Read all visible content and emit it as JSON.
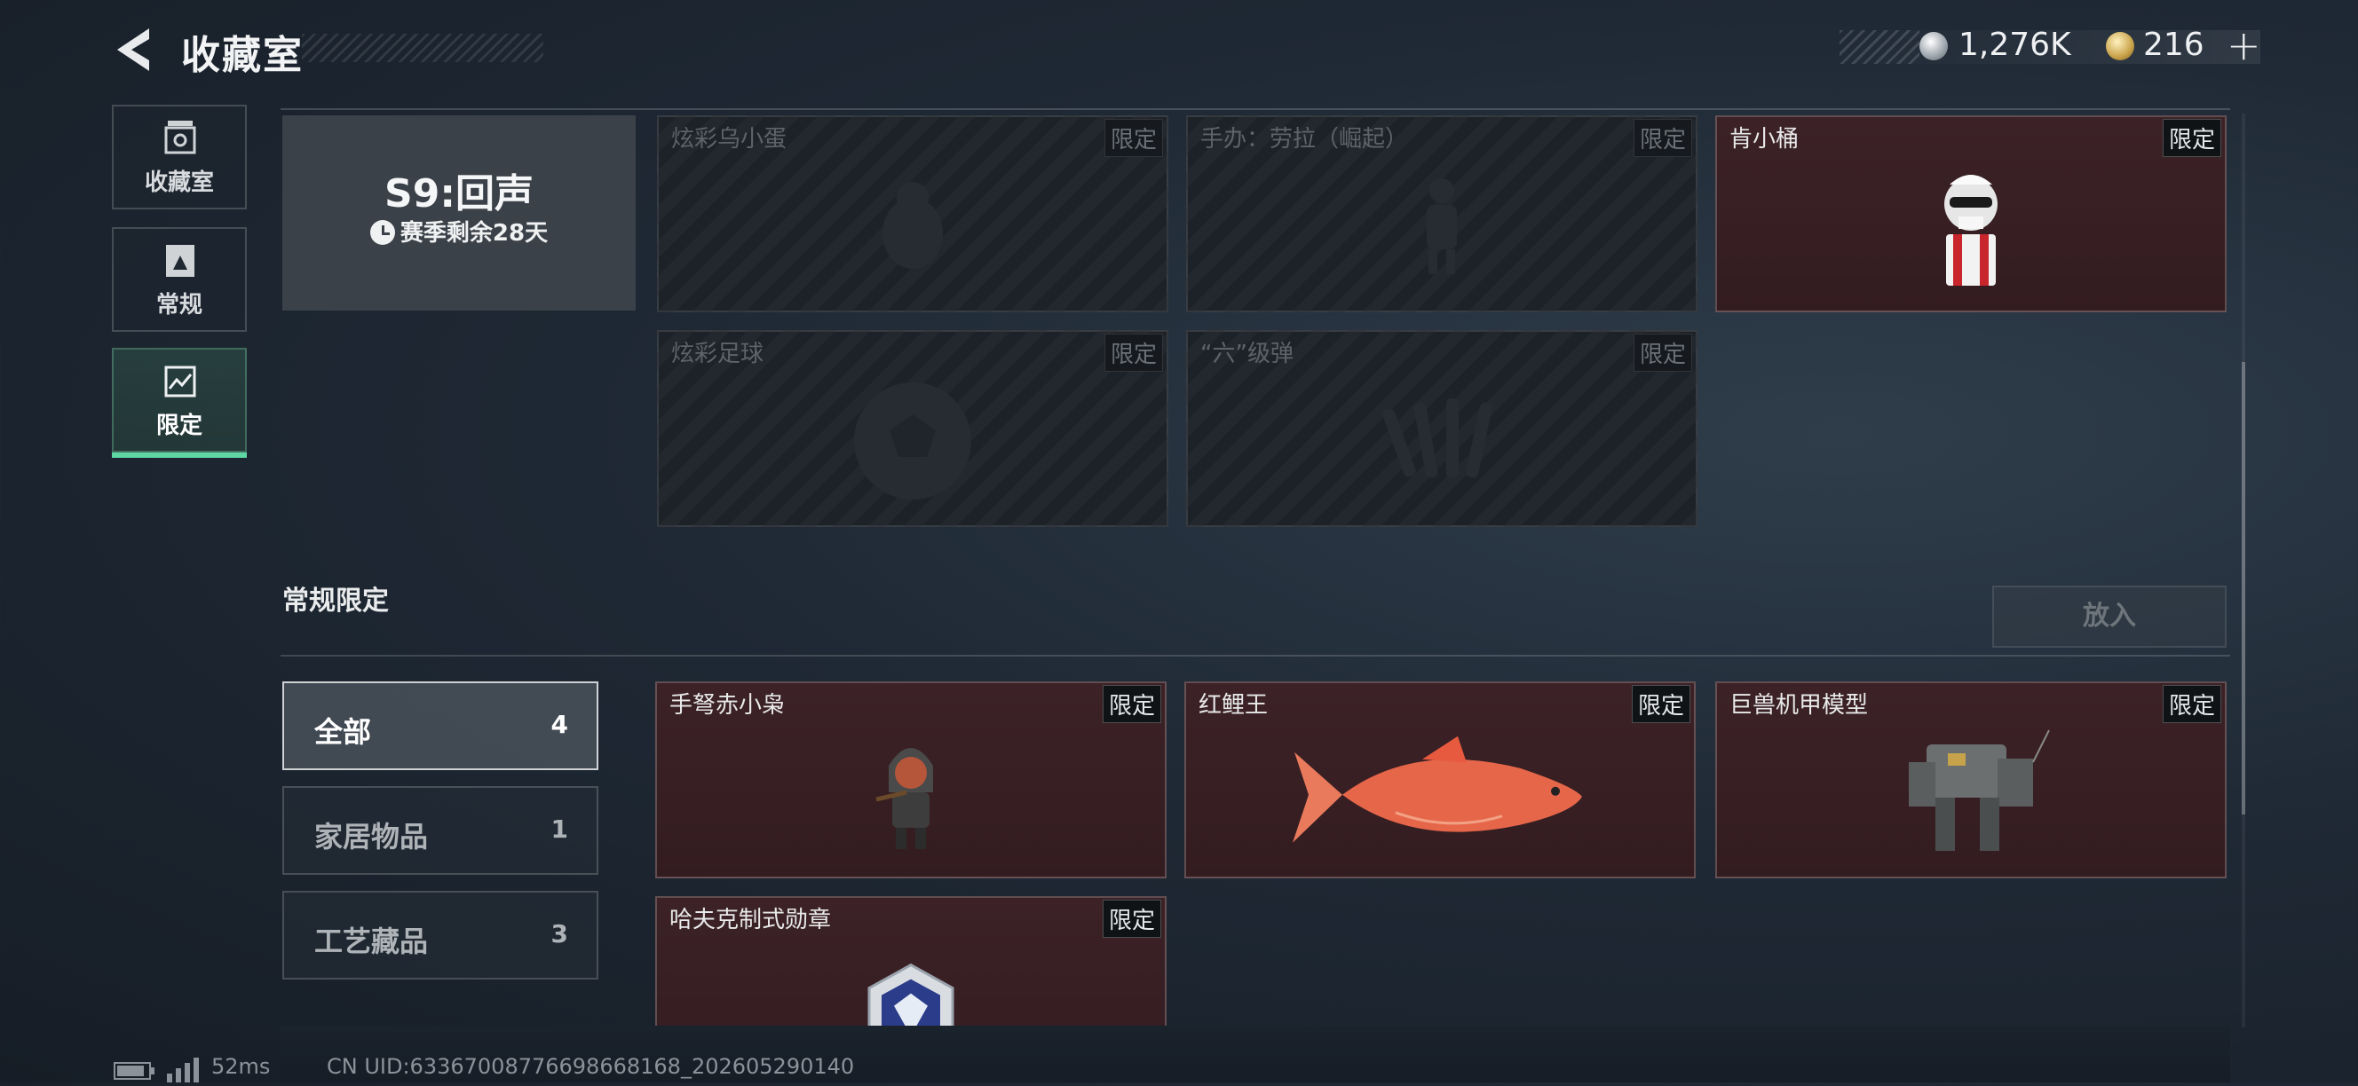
{
  "header": {
    "title": "收藏室",
    "currency1": "1,276K",
    "currency2": "216",
    "plus_label": "+"
  },
  "nav": [
    {
      "label": "收藏室",
      "icon": "trophy-icon",
      "active": false
    },
    {
      "label": "常规",
      "icon": "card-icon",
      "active": false
    },
    {
      "label": "限定",
      "icon": "limited-icon",
      "active": true
    }
  ],
  "season": {
    "title": "S9:回声",
    "remaining": "赛季剩余28天"
  },
  "season_items": [
    {
      "name": "炫彩乌小蛋",
      "badge": "限定",
      "owned": false
    },
    {
      "name": "手办：劳拉（崛起）",
      "badge": "限定",
      "owned": false
    },
    {
      "name": "肯小桶",
      "badge": "限定",
      "owned": true
    },
    {
      "name": "炫彩足球",
      "badge": "限定",
      "owned": false
    },
    {
      "name": "“六”级弹",
      "badge": "限定",
      "owned": false
    }
  ],
  "regular_section": {
    "title": "常规限定",
    "put_button": "放入"
  },
  "filters": [
    {
      "label": "全部",
      "count": "4",
      "active": true
    },
    {
      "label": "家居物品",
      "count": "1",
      "active": false
    },
    {
      "label": "工艺藏品",
      "count": "3",
      "active": false
    }
  ],
  "regular_items": [
    {
      "name": "手弩赤小枭",
      "badge": "限定"
    },
    {
      "name": "红鲤王",
      "badge": "限定"
    },
    {
      "name": "巨兽机甲模型",
      "badge": "限定"
    },
    {
      "name": "哈夫克制式勋章",
      "badge": "限定"
    }
  ],
  "status": {
    "ping": "52ms",
    "uid": "CN UID:63367008776698668168_202605290140"
  },
  "colors": {
    "accent": "#5fd7a4",
    "owned_card": "#3c2226",
    "background": "#1f2935"
  }
}
